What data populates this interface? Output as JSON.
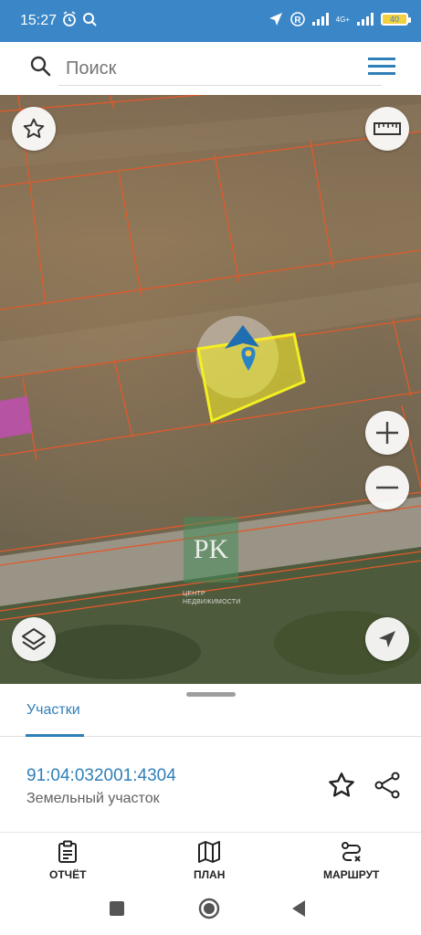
{
  "status_bar": {
    "time": "15:27",
    "network": "4G+",
    "battery": "40"
  },
  "search": {
    "placeholder": "Поиск"
  },
  "map": {
    "watermark_letters": "PK",
    "watermark_caption_line1": "ЦЕНТР",
    "watermark_caption_line2": "НЕДВИЖИМОСТИ",
    "parcel_highlight_color": "#f2ef22",
    "boundary_color": "#e2592a",
    "neighbor_highlight_color": "#c04fb0"
  },
  "sheet": {
    "tab_label": "Участки",
    "parcel_id": "91:04:032001:4304",
    "parcel_type": "Земельный участок"
  },
  "bottom_nav": {
    "items": [
      {
        "label": "ОТЧЁТ",
        "icon": "report-icon"
      },
      {
        "label": "ПЛАН",
        "icon": "map-icon"
      },
      {
        "label": "МАРШРУТ",
        "icon": "route-icon"
      }
    ]
  },
  "colors": {
    "accent": "#2f7fb9",
    "status_bar": "#3b86c6"
  }
}
